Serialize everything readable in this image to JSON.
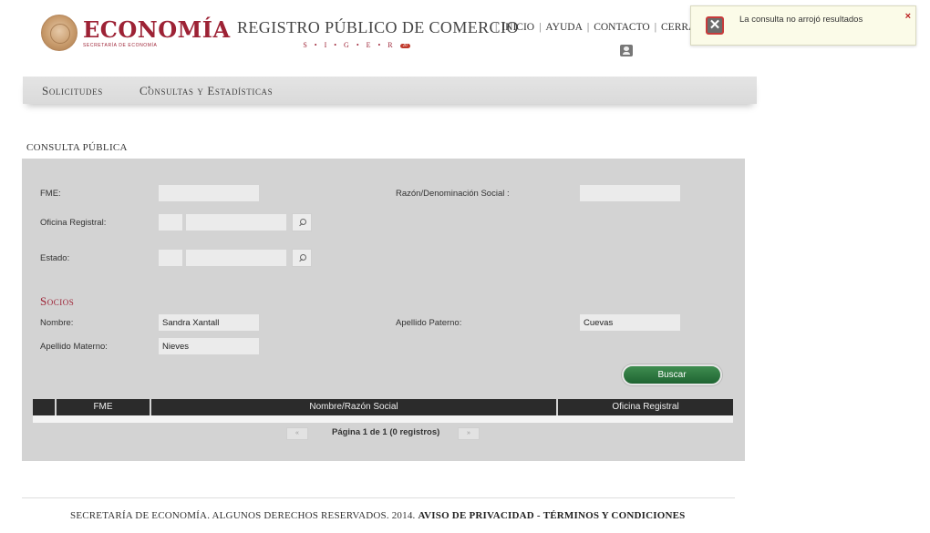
{
  "header": {
    "logo_text": "ECONOMÍA",
    "logo_subtext": "SECRETARÍA DE ECONOMÍA",
    "registro_title": "REGISTRO PÚBLICO DE COMERCIO",
    "registro_sub": "S • I • G • E • R",
    "registro_badge": "20",
    "nav": [
      {
        "label": "INICIO"
      },
      {
        "label": "AYUDA"
      },
      {
        "label": "CONTACTO"
      },
      {
        "label": "CERRA"
      }
    ]
  },
  "toast": {
    "message": "La consulta no arrojó resultados",
    "close": "×"
  },
  "breadcrumb": {
    "item1": "Solicitudes",
    "separator": "•",
    "item2": "Consultas y Estadísticas"
  },
  "section_label": "CONSULTA PÚBLICA",
  "form": {
    "fme_label": "FME:",
    "fme_value": "",
    "razon_label": "Razón/Denominación Social :",
    "razon_value": "",
    "oficina_label": "Oficina Registral:",
    "oficina_code": "",
    "oficina_name": "",
    "estado_label": "Estado:",
    "estado_code": "",
    "estado_name": "",
    "socios_title": "Socios",
    "nombre_label": "Nombre:",
    "nombre_value": "Sandra Xantall",
    "paterno_label": "Apellido Paterno:",
    "paterno_value": "Cuevas",
    "materno_label": "Apellido Materno:",
    "materno_value": "Nieves",
    "buscar_label": "Buscar"
  },
  "table": {
    "columns": [
      "",
      "FME",
      "Nombre/Razón Social",
      "Oficina Registral"
    ],
    "rows": []
  },
  "pager": {
    "prev": "«",
    "next": "»",
    "text": "Página 1 de 1 (0 registros)"
  },
  "footer": {
    "text": "SECRETARÍA DE ECONOMÍA. ALGUNOS DERECHOS RESERVADOS. 2014.",
    "privacy": "AVISO DE PRIVACIDAD",
    "dash": "-",
    "terms": "TÉRMINOS Y CONDICIONES"
  }
}
